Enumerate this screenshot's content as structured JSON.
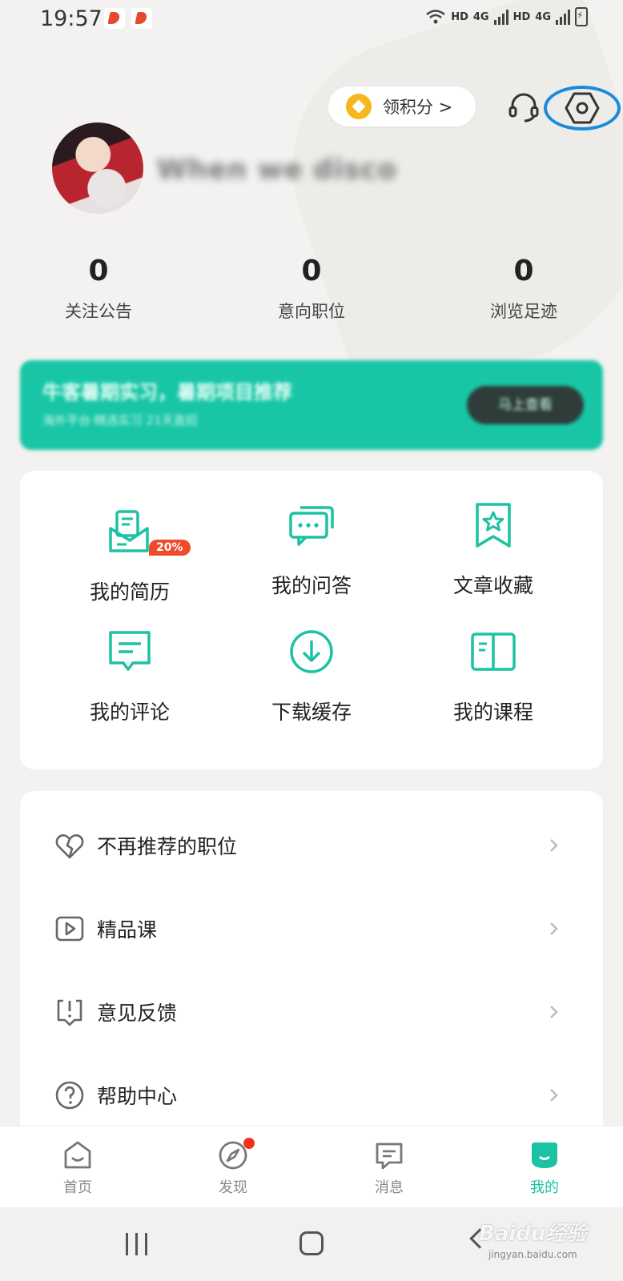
{
  "status_bar": {
    "time": "19:57",
    "network_hd_1": "HD",
    "network_4g_1": "4G",
    "network_hd_2": "HD",
    "network_4g_2": "4G"
  },
  "header": {
    "points_button": "领积分 >",
    "username": "When we disco"
  },
  "stats": [
    {
      "value": "0",
      "label": "关注公告"
    },
    {
      "value": "0",
      "label": "意向职位"
    },
    {
      "value": "0",
      "label": "浏览足迹"
    }
  ],
  "banner": {
    "title": "牛客暑期实习，暑期项目推荐",
    "subtitle": "海外平台·精选实习 21天直招",
    "button": "马上查看"
  },
  "grid": [
    {
      "label": "我的简历",
      "icon": "resume-icon",
      "badge": "20%"
    },
    {
      "label": "我的问答",
      "icon": "qa-icon"
    },
    {
      "label": "文章收藏",
      "icon": "bookmark-icon"
    },
    {
      "label": "我的评论",
      "icon": "comment-icon"
    },
    {
      "label": "下载缓存",
      "icon": "download-icon"
    },
    {
      "label": "我的课程",
      "icon": "book-icon"
    }
  ],
  "list": [
    {
      "label": "不再推荐的职位",
      "icon": "broken-heart-icon"
    },
    {
      "label": "精品课",
      "icon": "video-icon"
    },
    {
      "label": "意见反馈",
      "icon": "feedback-icon"
    },
    {
      "label": "帮助中心",
      "icon": "help-icon"
    }
  ],
  "tabs": [
    {
      "label": "首页",
      "icon": "home-icon",
      "active": false
    },
    {
      "label": "发现",
      "icon": "compass-icon",
      "active": false,
      "dot": true
    },
    {
      "label": "消息",
      "icon": "message-icon",
      "active": false
    },
    {
      "label": "我的",
      "icon": "profile-icon",
      "active": true
    }
  ],
  "watermark": {
    "brand": "Baidu经验",
    "url": "jingyan.baidu.com"
  },
  "colors": {
    "accent": "#1bc2a3",
    "badge": "#f04a2c",
    "highlight_ring": "#1a8bdc",
    "coin": "#f6b61e"
  }
}
